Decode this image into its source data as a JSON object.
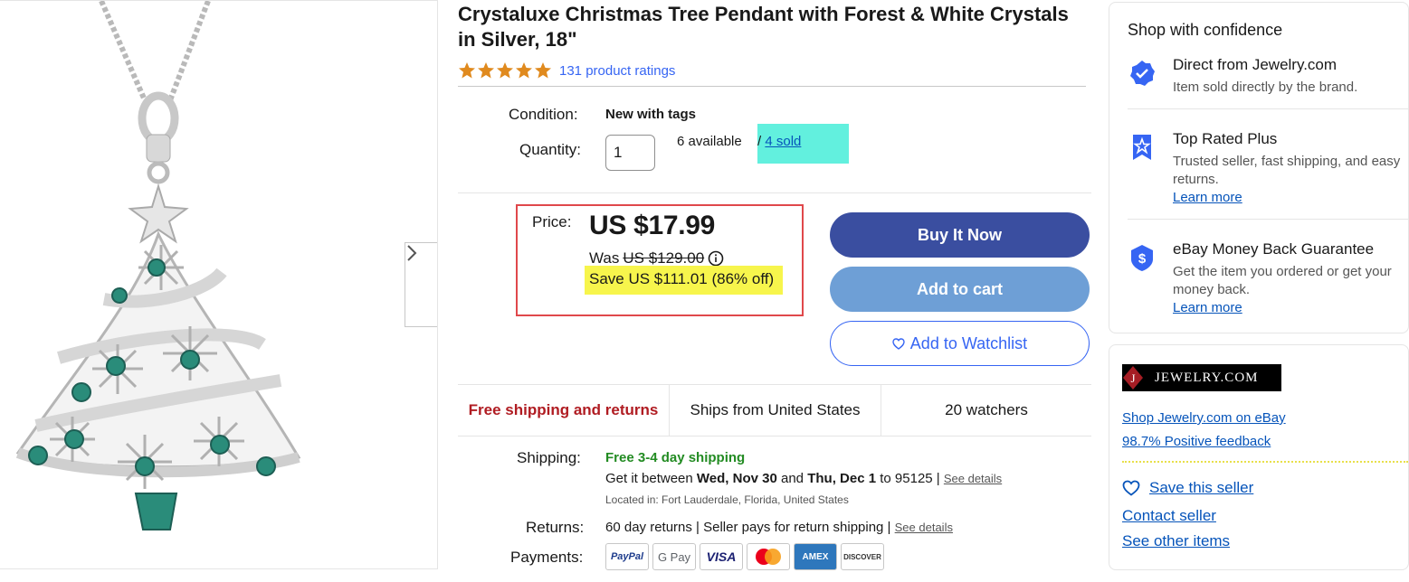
{
  "product": {
    "title": "Crystaluxe Christmas Tree Pendant with Forest & White Crystals in Silver, 18\"",
    "ratings_link": "131 product ratings",
    "star_rating": 5
  },
  "condition": {
    "label": "Condition:",
    "value": "New with tags"
  },
  "quantity": {
    "label": "Quantity:",
    "value": "1",
    "available": "6 available",
    "separator": "/",
    "sold_link": "4 sold"
  },
  "price": {
    "label": "Price:",
    "value": "US $17.99",
    "was_label": "Was",
    "was_value": "US $129.00",
    "info_icon": "info-icon",
    "save": "Save US $111.01 (86% off)"
  },
  "buttons": {
    "buy_now": "Buy It Now",
    "add_to_cart": "Add to cart",
    "watchlist": "Add to Watchlist"
  },
  "info_strip": {
    "free_shipping": "Free shipping and returns",
    "ships_from": "Ships from United States",
    "watchers": "20 watchers"
  },
  "shipping": {
    "label": "Shipping:",
    "free": "Free 3-4 day shipping",
    "get_it": "Get it between",
    "date_start": "Wed, Nov 30",
    "and": "and",
    "date_end": "Thu, Dec 1",
    "to": "to 95125 |",
    "see_details": "See details",
    "located": "Located in: Fort Lauderdale, Florida, United States"
  },
  "returns": {
    "label": "Returns:",
    "value": "60 day returns | Seller pays for return shipping |",
    "see_details": "See details"
  },
  "payments": {
    "label": "Payments:",
    "methods": [
      "PayPal",
      "G Pay",
      "VISA",
      "",
      "AMEX",
      "DISCOVER"
    ]
  },
  "confidence": {
    "title": "Shop with confidence",
    "items": [
      {
        "heading": "Direct from Jewelry.com",
        "body": "Item sold directly by the brand.",
        "link": ""
      },
      {
        "heading": "Top Rated Plus",
        "body": "Trusted seller, fast shipping, and easy returns.",
        "link": "Learn more"
      },
      {
        "heading": "eBay Money Back Guarantee",
        "body": "Get the item you ordered or get your money back.",
        "link": "Learn more"
      }
    ]
  },
  "seller": {
    "logo_text": "JEWELRY.COM",
    "logo_letter": "J",
    "shop_link": "Shop Jewelry.com on eBay",
    "feedback_link": "98.7% Positive feedback",
    "save_seller": "Save this seller",
    "contact_seller": "Contact seller",
    "see_other": "See other items"
  },
  "colors": {
    "accent_blue": "#3665f3",
    "buy_button": "#3a4ea0",
    "cart_button": "#6e9fd6",
    "free_shipping_red": "#b01c22",
    "price_box_border": "#e0484b",
    "sold_highlight": "#62f0de",
    "save_highlight": "#f7f54c",
    "shipping_green": "#228b22"
  }
}
